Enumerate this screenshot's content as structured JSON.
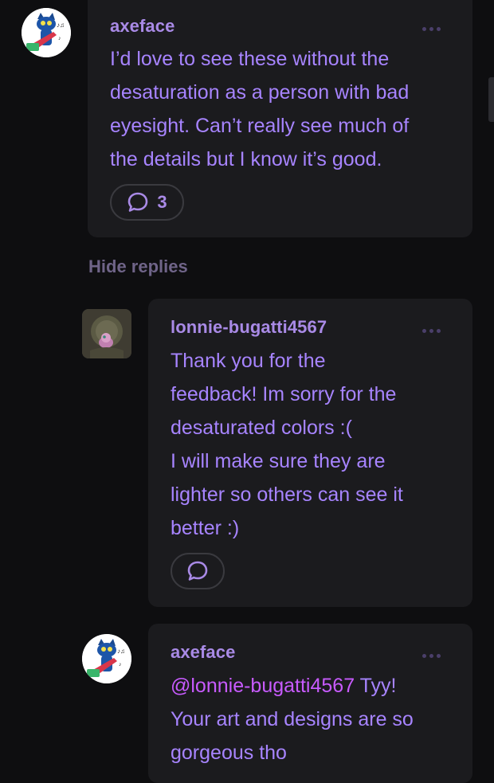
{
  "comments": [
    {
      "username": "axeface",
      "lines": [
        "I’d love to see these without the",
        "desaturation as a person with bad",
        "eyesight. Can’t really see much of",
        "the details but I know it’s good."
      ],
      "reply_count": "3"
    },
    {
      "username": "lonnie-bugatti4567",
      "lines": [
        "Thank you for the",
        "feedback! Im sorry for the",
        "desaturated colors :(",
        "I will make sure they are",
        "lighter so others can see it",
        "better :)"
      ]
    },
    {
      "username": "axeface",
      "mention": "@lonnie-bugatti4567",
      "first_line_rest": " Tyy!",
      "lines": [
        "Your art and designs are so",
        "gorgeous tho"
      ]
    }
  ],
  "hide_replies_label": "Hide replies",
  "icons": {
    "more": "more-options-icon",
    "reply": "speech-bubble-icon"
  },
  "colors": {
    "background": "#0e0e10",
    "card": "#1b1b1e",
    "text": "#a784ff",
    "mention": "#c85bff",
    "muted": "#6f6488"
  }
}
